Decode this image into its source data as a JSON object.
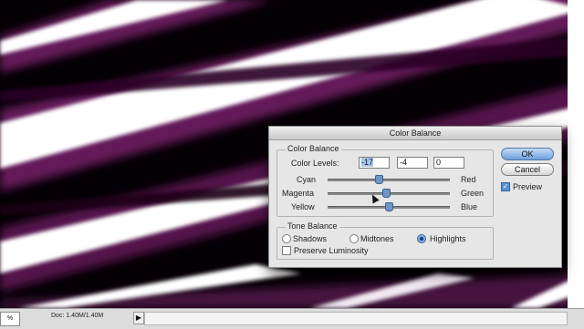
{
  "dialog": {
    "title": "Color Balance",
    "color_balance_group": "Color Balance",
    "color_levels_label": "Color Levels:",
    "levels": [
      "-17",
      "-4",
      "0"
    ],
    "sliders": [
      {
        "left": "Cyan",
        "right": "Red",
        "value": -17
      },
      {
        "left": "Magenta",
        "right": "Green",
        "value": -4
      },
      {
        "left": "Yellow",
        "right": "Blue",
        "value": 0
      }
    ],
    "tone_balance_group": "Tone Balance",
    "tones": [
      {
        "label": "Shadows",
        "selected": false
      },
      {
        "label": "Midtones",
        "selected": false
      },
      {
        "label": "Highlights",
        "selected": true
      }
    ],
    "preserve_luminosity": {
      "label": "Preserve Luminosity",
      "checked": false
    },
    "ok_label": "OK",
    "cancel_label": "Cancel",
    "preview": {
      "label": "Preview",
      "checked": true
    }
  },
  "status": {
    "zoom": "%",
    "doc": "Doc: 1.40M/1.40M",
    "arrow": "▶"
  },
  "colors": {
    "canvas_dark": "#050005",
    "canvas_purple": "#6b1f5e",
    "highlight_white": "#ffffff",
    "button_default": "#6d9fdc"
  }
}
